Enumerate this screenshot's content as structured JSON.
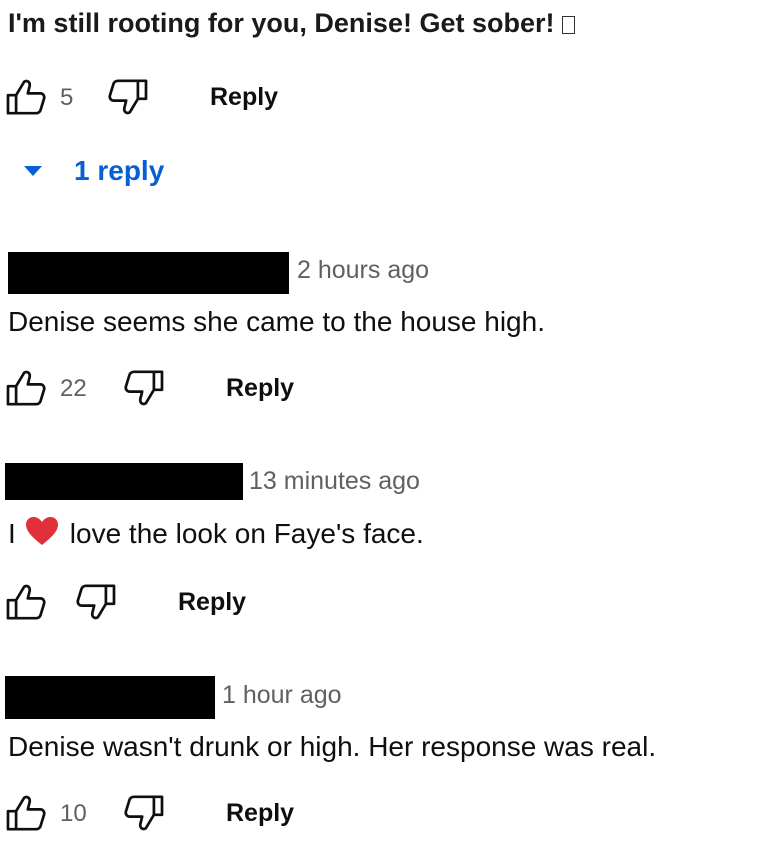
{
  "top_comment": {
    "text": "I'm still rooting for you, Denise! Get sober!",
    "like_count": "5",
    "reply_label": "Reply",
    "replies_toggle": "1 reply"
  },
  "replies": [
    {
      "timestamp": "2 hours ago",
      "text": "Denise seems she came to the house high.",
      "like_count": "22",
      "reply_label": "Reply"
    },
    {
      "timestamp": "13 minutes ago",
      "text_before_emoji": "I",
      "text_after_emoji": "love the look on Faye's face.",
      "emoji": "heart",
      "like_count": "",
      "reply_label": "Reply"
    },
    {
      "timestamp": "1 hour ago",
      "text": "Denise wasn't drunk or high.  Her response was real.",
      "like_count": "10",
      "reply_label": "Reply"
    }
  ],
  "icons": {
    "like": "thumbs-up-icon",
    "dislike": "thumbs-down-icon",
    "expand": "caret-down-icon",
    "emoji": "red-heart-icon"
  },
  "colors": {
    "link_blue": "#065fd4",
    "muted_gray": "#606060",
    "heart_red": "#e0303a"
  }
}
